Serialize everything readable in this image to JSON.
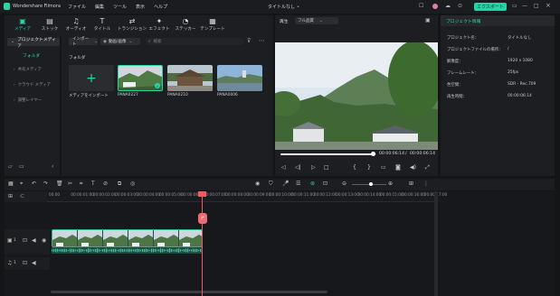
{
  "app": {
    "name": "Wondershare Filmora",
    "menus": [
      "ファイル",
      "編集",
      "ツール",
      "表示",
      "ヘルプ"
    ],
    "project_title": "タイトルなし",
    "export_label": "エクスポート"
  },
  "toolbar_tabs": [
    {
      "label": "メディア",
      "icon": "media-icon",
      "active": true
    },
    {
      "label": "ストック",
      "icon": "stock-icon",
      "active": false
    },
    {
      "label": "オーディオ",
      "icon": "audio-icon",
      "active": false
    },
    {
      "label": "タイトル",
      "icon": "title-icon",
      "active": false
    },
    {
      "label": "トランジション",
      "icon": "transition-icon",
      "active": false
    },
    {
      "label": "エフェクト",
      "icon": "effect-icon",
      "active": false
    },
    {
      "label": "ステッカー",
      "icon": "sticker-icon",
      "active": false
    },
    {
      "label": "テンプレート",
      "icon": "template-icon",
      "active": false
    }
  ],
  "sidebar": {
    "project_media": "プロジェクトメディア",
    "folder": "フォルダ",
    "items": [
      "共有メディア",
      "クラウド メディア",
      "調整レイヤー"
    ]
  },
  "media": {
    "import_label": "インポート",
    "sort_label": "動画/画像",
    "search_placeholder": "検索",
    "folder_label": "フォルダ",
    "items": [
      {
        "label": "メディアをインポート",
        "type": "import"
      },
      {
        "label": "PANA0227",
        "type": "clip",
        "selected": true
      },
      {
        "label": "PANA0210",
        "type": "clip",
        "selected": false
      },
      {
        "label": "PANA0006",
        "type": "clip",
        "selected": false
      }
    ]
  },
  "preview": {
    "tab": "再生",
    "quality": "フル品質",
    "current_time": "00:00:06:14",
    "total_time": "00:00:06:14",
    "separator": "/",
    "progress": 0.97
  },
  "properties": {
    "header": "プロジェクト情報",
    "rows": [
      {
        "key": "プロジェクト名：",
        "value": "タイトルなし"
      },
      {
        "key": "プロジェクトファイルの場所：",
        "value": "/"
      },
      {
        "key": "解像度：",
        "value": "1920 x 1080"
      },
      {
        "key": "フレームレート：",
        "value": "25fps"
      },
      {
        "key": "色空間：",
        "value": "SDR - Rec.709"
      },
      {
        "key": "再生時間：",
        "value": "00:00:06:14"
      }
    ]
  },
  "timeline": {
    "ticks": [
      "00:00",
      "00:00:01:00",
      "00:00:02:00",
      "00:00:03:00",
      "00:00:04:00",
      "00:00:05:00",
      "00:00:06:00",
      "00:00:07:00",
      "00:00:08:00",
      "00:00:09:00",
      "00:00:10:00",
      "00:00:11:00",
      "00:00:12:00",
      "00:00:13:00",
      "00:00:14:00",
      "00:00:15:00",
      "00:00:16:00",
      "00:00:17:00"
    ],
    "video_track": "1",
    "audio_track": "1"
  },
  "colors": {
    "accent": "#2bd3a6",
    "playhead": "#ee5b63",
    "panel": "#1d1e21",
    "background": "#141517"
  }
}
